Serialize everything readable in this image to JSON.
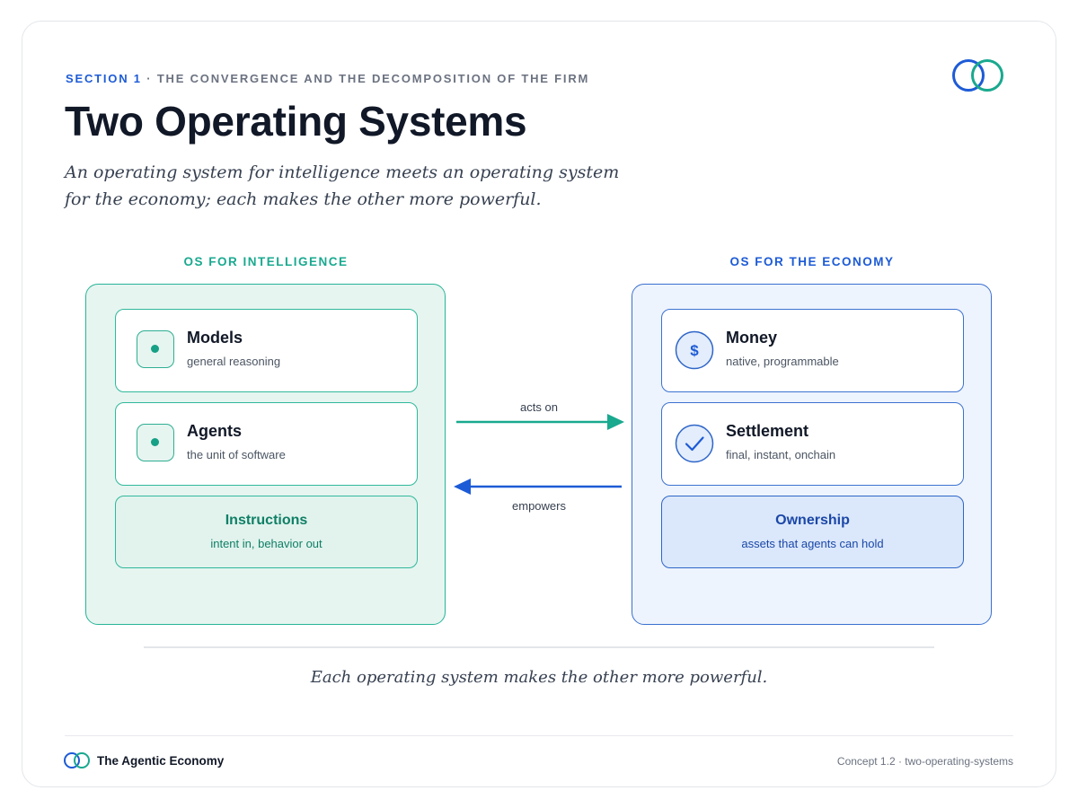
{
  "header": {
    "section_number": "SECTION 1",
    "section_separator": "·",
    "section_title": "THE CONVERGENCE AND THE DECOMPOSITION OF THE FIRM",
    "title": "Two Operating Systems",
    "subtitle": "An operating system for intelligence meets an operating system for the economy; each makes the other more powerful."
  },
  "left_column": {
    "title": "OS FOR INTELLIGENCE",
    "items": [
      {
        "name": "Models",
        "desc": "general reasoning",
        "icon": "dot-square-icon"
      },
      {
        "name": "Agents",
        "desc": "the unit of software",
        "icon": "dot-square-icon"
      },
      {
        "name": "Instructions",
        "desc": "intent in, behavior out"
      }
    ]
  },
  "right_column": {
    "title": "OS FOR THE ECONOMY",
    "items": [
      {
        "name": "Money",
        "desc": "native, programmable",
        "icon": "dollar-icon",
        "glyph": "$"
      },
      {
        "name": "Settlement",
        "desc": "final, instant, onchain",
        "icon": "check-icon"
      },
      {
        "name": "Ownership",
        "desc": "assets that agents can hold"
      }
    ]
  },
  "arrows": {
    "forward_label": "acts on",
    "backward_label": "empowers"
  },
  "caption": "Each operating system makes the other more powerful.",
  "footer": {
    "brand": "The Agentic Economy",
    "meta": "Concept 1.2 · two-operating-systems"
  },
  "colors": {
    "teal": "#19a98f",
    "blue": "#1d5bd6",
    "text": "#111827"
  }
}
